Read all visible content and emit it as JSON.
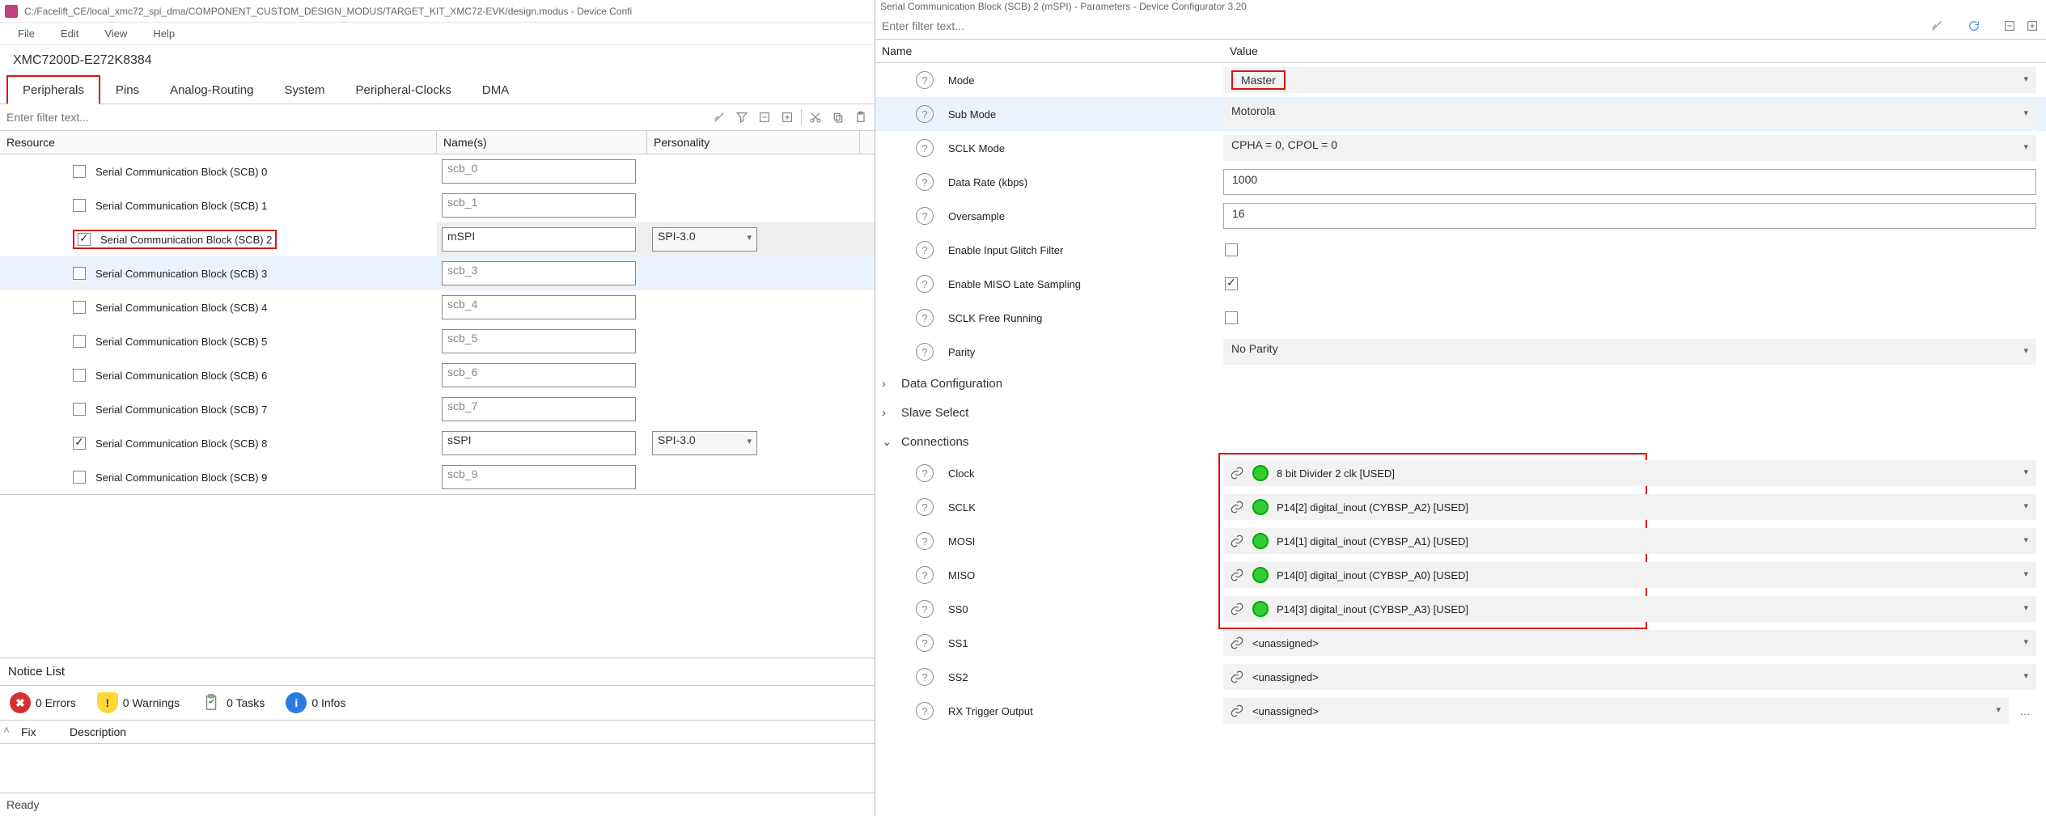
{
  "left": {
    "title": "C:/Facelift_CE/local_xmc72_spi_dma/COMPONENT_CUSTOM_DESIGN_MODUS/TARGET_KIT_XMC72-EVK/design.modus - Device Confi",
    "menu": [
      "File",
      "Edit",
      "View",
      "Help"
    ],
    "chip": "XMC7200D-E272K8384",
    "tabs": [
      "Peripherals",
      "Pins",
      "Analog-Routing",
      "System",
      "Peripheral-Clocks",
      "DMA"
    ],
    "active_tab": 0,
    "filter_placeholder": "Enter filter text...",
    "columns": [
      "Resource",
      "Name(s)",
      "Personality"
    ],
    "rows": [
      {
        "checked": false,
        "label": "Serial Communication Block (SCB) 0",
        "name": "scb_0",
        "dim": true,
        "pers": ""
      },
      {
        "checked": false,
        "label": "Serial Communication Block (SCB) 1",
        "name": "scb_1",
        "dim": true,
        "pers": ""
      },
      {
        "checked": true,
        "label": "Serial Communication Block (SCB) 2",
        "name": "mSPI",
        "dim": false,
        "pers": "SPI-3.0",
        "red": true,
        "selbg": true
      },
      {
        "checked": false,
        "label": "Serial Communication Block (SCB) 3",
        "name": "scb_3",
        "dim": true,
        "pers": "",
        "hover": true
      },
      {
        "checked": false,
        "label": "Serial Communication Block (SCB) 4",
        "name": "scb_4",
        "dim": true,
        "pers": ""
      },
      {
        "checked": false,
        "label": "Serial Communication Block (SCB) 5",
        "name": "scb_5",
        "dim": true,
        "pers": ""
      },
      {
        "checked": false,
        "label": "Serial Communication Block (SCB) 6",
        "name": "scb_6",
        "dim": true,
        "pers": ""
      },
      {
        "checked": false,
        "label": "Serial Communication Block (SCB) 7",
        "name": "scb_7",
        "dim": true,
        "pers": ""
      },
      {
        "checked": true,
        "label": "Serial Communication Block (SCB) 8",
        "name": "sSPI",
        "dim": false,
        "pers": "SPI-3.0"
      },
      {
        "checked": false,
        "label": "Serial Communication Block (SCB) 9",
        "name": "scb_9",
        "dim": true,
        "pers": ""
      }
    ],
    "notice_title": "Notice List",
    "chips": {
      "errors": "0 Errors",
      "warnings": "0 Warnings",
      "tasks": "0 Tasks",
      "infos": "0 Infos"
    },
    "fix": "Fix",
    "desc": "Description",
    "status": "Ready"
  },
  "right": {
    "title": "Serial Communication Block (SCB) 2 (mSPI) - Parameters - Device Configurator 3.20",
    "filter_placeholder": "Enter filter text...",
    "head_name": "Name",
    "head_value": "Value",
    "params": [
      {
        "k": "Mode",
        "v": "Master",
        "type": "select",
        "red": true
      },
      {
        "k": "Sub Mode",
        "v": "Motorola",
        "type": "select",
        "hl": true
      },
      {
        "k": "SCLK Mode",
        "v": "CPHA = 0, CPOL = 0",
        "type": "select"
      },
      {
        "k": "Data Rate (kbps)",
        "v": "1000",
        "type": "text"
      },
      {
        "k": "Oversample",
        "v": "16",
        "type": "text"
      },
      {
        "k": "Enable Input Glitch Filter",
        "v": false,
        "type": "check"
      },
      {
        "k": "Enable MISO Late Sampling",
        "v": true,
        "type": "check"
      },
      {
        "k": "SCLK Free Running",
        "v": false,
        "type": "check"
      },
      {
        "k": "Parity",
        "v": "No Parity",
        "type": "select"
      }
    ],
    "sections": [
      {
        "caret": "›",
        "label": "Data Configuration"
      },
      {
        "caret": "›",
        "label": "Slave Select"
      },
      {
        "caret": "⌄",
        "label": "Connections"
      }
    ],
    "connections": [
      {
        "k": "Clock",
        "v": "8 bit Divider 2 clk [USED]",
        "dot": true
      },
      {
        "k": "SCLK",
        "v": "P14[2] digital_inout (CYBSP_A2) [USED]",
        "dot": true
      },
      {
        "k": "MOSI",
        "v": "P14[1] digital_inout (CYBSP_A1) [USED]",
        "dot": true
      },
      {
        "k": "MISO",
        "v": "P14[0] digital_inout (CYBSP_A0) [USED]",
        "dot": true
      },
      {
        "k": "SS0",
        "v": "P14[3] digital_inout (CYBSP_A3) [USED]",
        "dot": true
      },
      {
        "k": "SS1",
        "v": "<unassigned>",
        "dot": false
      },
      {
        "k": "SS2",
        "v": "<unassigned>",
        "dot": false
      },
      {
        "k": "RX Trigger Output",
        "v": "<unassigned>",
        "dot": false,
        "ell": true
      }
    ]
  }
}
